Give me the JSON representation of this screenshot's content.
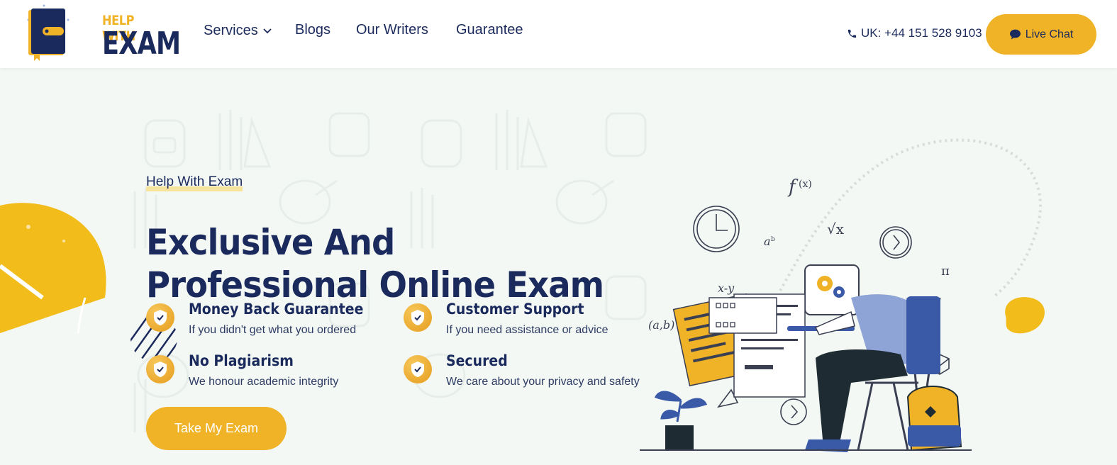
{
  "header": {
    "logo": {
      "line1": "HELP WITH",
      "line2": "EXAM"
    },
    "nav": [
      {
        "label": "Services",
        "has_dropdown": true
      },
      {
        "label": "Blogs"
      },
      {
        "label": "Our Writers"
      },
      {
        "label": "Guarantee"
      }
    ],
    "phone": "UK: +44 151 528 9103",
    "live_chat_label": "Live Chat"
  },
  "hero": {
    "eyebrow": "Help With Exam",
    "title": "Exclusive And Professional Online Exam Help By Experts",
    "features": [
      {
        "title": "Money Back Guarantee",
        "description": "If you didn't get what you ordered"
      },
      {
        "title": "Customer Support",
        "description": "If you need assistance or advice"
      },
      {
        "title": "No Plagiarism",
        "description": "We honour academic integrity"
      },
      {
        "title": "Secured",
        "description": "We care about your privacy and safety"
      }
    ],
    "cta_label": "Take My Exam"
  },
  "colors": {
    "navy": "#1b2a5c",
    "accent": "#f0b327",
    "background": "#f3f8f4"
  }
}
